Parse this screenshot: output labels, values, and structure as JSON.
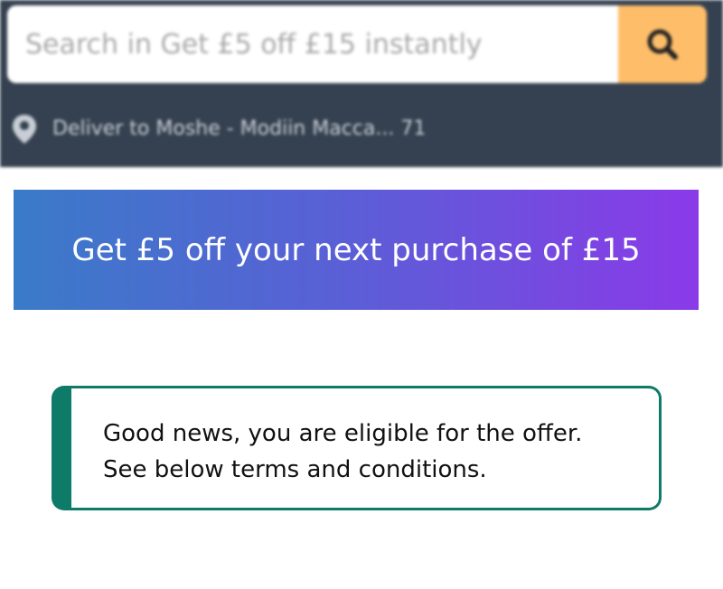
{
  "search": {
    "placeholder": "Search in Get £5 off £15 instantly",
    "button_icon": "magnifier-icon",
    "button_color": "#febd69"
  },
  "deliver": {
    "icon": "location-pin-icon",
    "text": "Deliver to Moshe - Modiin Macca... 71"
  },
  "promo": {
    "title": "Get £5 off your next purchase of £15",
    "gradient_start": "#3a7bc8",
    "gradient_end": "#8a3ae8"
  },
  "alert": {
    "line1": "Good news, you are eligible for the offer.",
    "line2": "See below terms and conditions.",
    "accent_color": "#0e7a68"
  },
  "colors": {
    "header_bg": "#354150"
  }
}
